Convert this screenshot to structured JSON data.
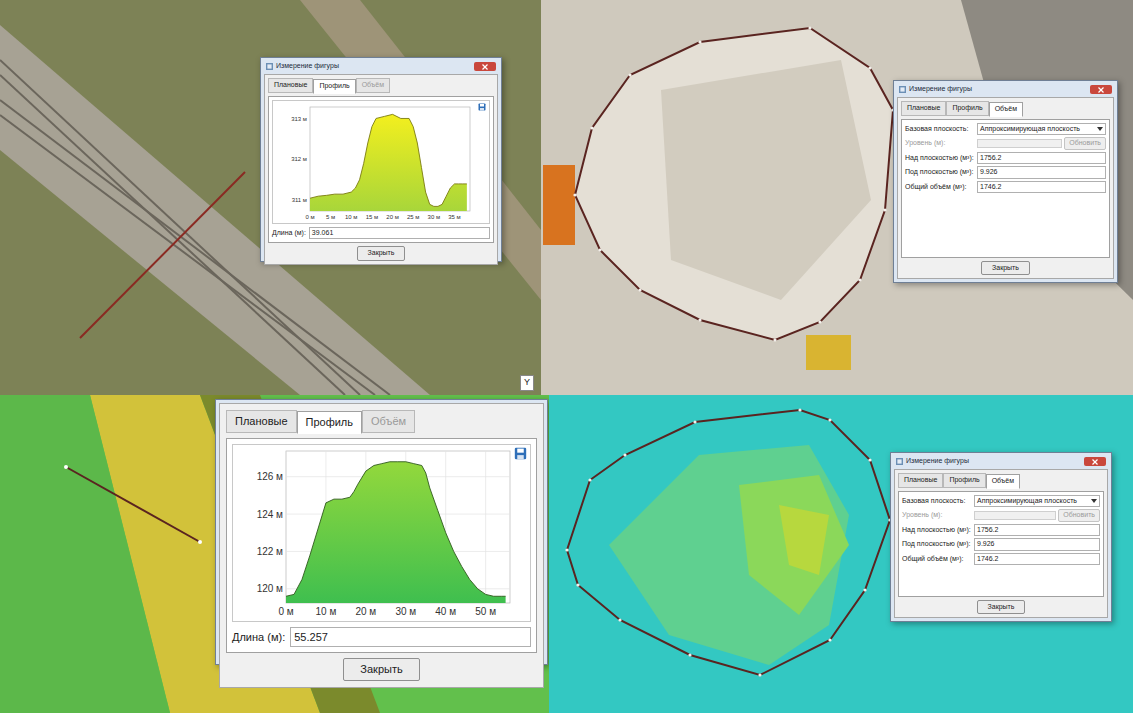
{
  "panels": [
    {
      "kind": "profile",
      "view": "orthophoto",
      "window": {
        "title": "Измерение фигуры"
      },
      "tabs": [
        {
          "label": "Плановые",
          "selected": false,
          "disabled": false
        },
        {
          "label": "Профиль",
          "selected": true,
          "disabled": false
        },
        {
          "label": "Объём",
          "selected": false,
          "disabled": true
        }
      ],
      "chart": {
        "y_ticks": [
          "313 м",
          "312 м",
          "311 м"
        ],
        "x_ticks": [
          "0 м",
          "5 м",
          "10 м",
          "15 м",
          "20 м",
          "25 м",
          "30 м",
          "35 м"
        ],
        "x": [
          0,
          2,
          4,
          6,
          8,
          10,
          11,
          12,
          13,
          14,
          15,
          16,
          18,
          20,
          22,
          24,
          25,
          26,
          27,
          28,
          29,
          30,
          31,
          32,
          33,
          34,
          35,
          36,
          37,
          38
        ],
        "values": [
          311.05,
          311.1,
          311.12,
          311.15,
          311.15,
          311.2,
          311.3,
          311.5,
          311.9,
          312.4,
          312.8,
          313.0,
          313.05,
          313.1,
          313.0,
          313.0,
          312.8,
          312.4,
          311.8,
          311.2,
          310.9,
          310.85,
          310.85,
          310.9,
          311.1,
          311.3,
          311.4,
          311.4,
          311.4,
          311.4
        ]
      },
      "length": {
        "label": "Длина (м):",
        "value": "39.061"
      },
      "buttons": [
        "Закрыть"
      ],
      "axis_marker": "Y"
    },
    {
      "kind": "volume",
      "view": "orthophoto",
      "window": {
        "title": "Измерение фигуры"
      },
      "tabs": [
        {
          "label": "Плановые",
          "selected": false,
          "disabled": false
        },
        {
          "label": "Профиль",
          "selected": false,
          "disabled": false
        },
        {
          "label": "Объём",
          "selected": true,
          "disabled": false
        }
      ],
      "fields": [
        {
          "label": "Базовая плоскость:",
          "value": "Аппроксимирующая плоскость",
          "kind": "dropdown",
          "disabled": false
        },
        {
          "label": "Уровень (м):",
          "value": "",
          "kind": "input",
          "disabled": true,
          "button": {
            "label": "Обновить",
            "disabled": true
          }
        },
        {
          "label": "Над плоскостью (м³):",
          "value": "1756.2",
          "kind": "input",
          "disabled": false
        },
        {
          "label": "Под плоскостью (м³):",
          "value": "9.926",
          "kind": "input",
          "disabled": false
        },
        {
          "label": "Общий объём (м³):",
          "value": "1746.2",
          "kind": "input",
          "disabled": false
        }
      ],
      "buttons": [
        "Закрыть"
      ]
    },
    {
      "kind": "profile",
      "view": "elevation",
      "tabs": [
        {
          "label": "Плановые",
          "selected": false,
          "disabled": false
        },
        {
          "label": "Профиль",
          "selected": true,
          "disabled": false
        },
        {
          "label": "Объём",
          "selected": false,
          "disabled": true
        }
      ],
      "chart": {
        "y_ticks": [
          "126 м",
          "124 м",
          "122 м",
          "120 м"
        ],
        "x_ticks": [
          "0 м",
          "10 м",
          "20 м",
          "30 м",
          "40 м",
          "50 м"
        ],
        "x": [
          0,
          2,
          4,
          6,
          8,
          10,
          12,
          14,
          16,
          17,
          18,
          20,
          22,
          24,
          26,
          28,
          30,
          32,
          34,
          35,
          36,
          38,
          40,
          42,
          44,
          46,
          48,
          50,
          52,
          54,
          55
        ],
        "values": [
          119.6,
          119.7,
          120.5,
          121.8,
          123.2,
          124.6,
          124.8,
          124.8,
          124.9,
          125.2,
          125.6,
          126.3,
          126.6,
          126.7,
          126.8,
          126.8,
          126.8,
          126.7,
          126.6,
          126.2,
          125.4,
          124.2,
          123.0,
          122.0,
          121.2,
          120.5,
          120.0,
          119.7,
          119.6,
          119.6,
          119.6
        ]
      },
      "length": {
        "label": "Длина (м):",
        "value": "55.257"
      },
      "buttons": [
        "Закрыть"
      ]
    },
    {
      "kind": "volume",
      "view": "elevation",
      "window": {
        "title": "Измерение фигуры"
      },
      "tabs": [
        {
          "label": "Плановые",
          "selected": false,
          "disabled": false
        },
        {
          "label": "Профиль",
          "selected": false,
          "disabled": false
        },
        {
          "label": "Объём",
          "selected": true,
          "disabled": false
        }
      ],
      "fields": [
        {
          "label": "Базовая плоскость:",
          "value": "Аппроксимирующая плоскость",
          "kind": "dropdown",
          "disabled": false
        },
        {
          "label": "Уровень (м):",
          "value": "",
          "kind": "input",
          "disabled": true,
          "button": {
            "label": "Обновить",
            "disabled": true
          }
        },
        {
          "label": "Над плоскостью (м³):",
          "value": "1756.2",
          "kind": "input",
          "disabled": false
        },
        {
          "label": "Под плоскостью (м³):",
          "value": "9.926",
          "kind": "input",
          "disabled": false
        },
        {
          "label": "Общий объём (м³):",
          "value": "1746.2",
          "kind": "input",
          "disabled": false
        }
      ],
      "buttons": [
        "Закрыть"
      ]
    }
  ]
}
